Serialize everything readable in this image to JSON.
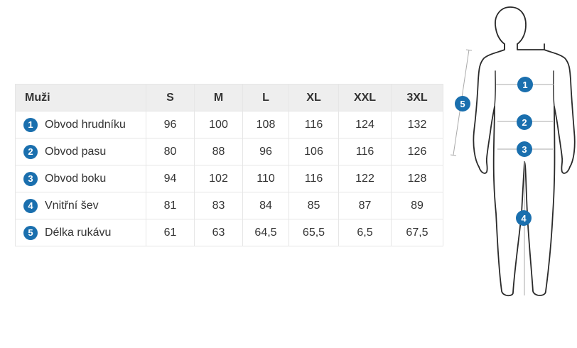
{
  "table": {
    "header": [
      "Muži",
      "S",
      "M",
      "L",
      "XL",
      "XXL",
      "3XL"
    ],
    "rows": [
      {
        "num": "1",
        "label": "Obvod hrudníku",
        "values": [
          "96",
          "100",
          "108",
          "116",
          "124",
          "132"
        ]
      },
      {
        "num": "2",
        "label": "Obvod pasu",
        "values": [
          "80",
          "88",
          "96",
          "106",
          "116",
          "126"
        ]
      },
      {
        "num": "3",
        "label": "Obvod boku",
        "values": [
          "94",
          "102",
          "110",
          "116",
          "122",
          "128"
        ]
      },
      {
        "num": "4",
        "label": "Vnitřní šev",
        "values": [
          "81",
          "83",
          "84",
          "85",
          "87",
          "89"
        ]
      },
      {
        "num": "5",
        "label": "Délka rukávu",
        "values": [
          "61",
          "63",
          "64,5",
          "65,5",
          "6,5",
          "67,5"
        ]
      }
    ]
  },
  "figure": {
    "markers": [
      "1",
      "2",
      "3",
      "4",
      "5"
    ]
  },
  "colors": {
    "accent": "#1a6fae",
    "header_bg": "#eeeeee",
    "border": "#e6e6e6",
    "outline": "#2a2a2a",
    "measure_line": "#aaaaaa"
  }
}
